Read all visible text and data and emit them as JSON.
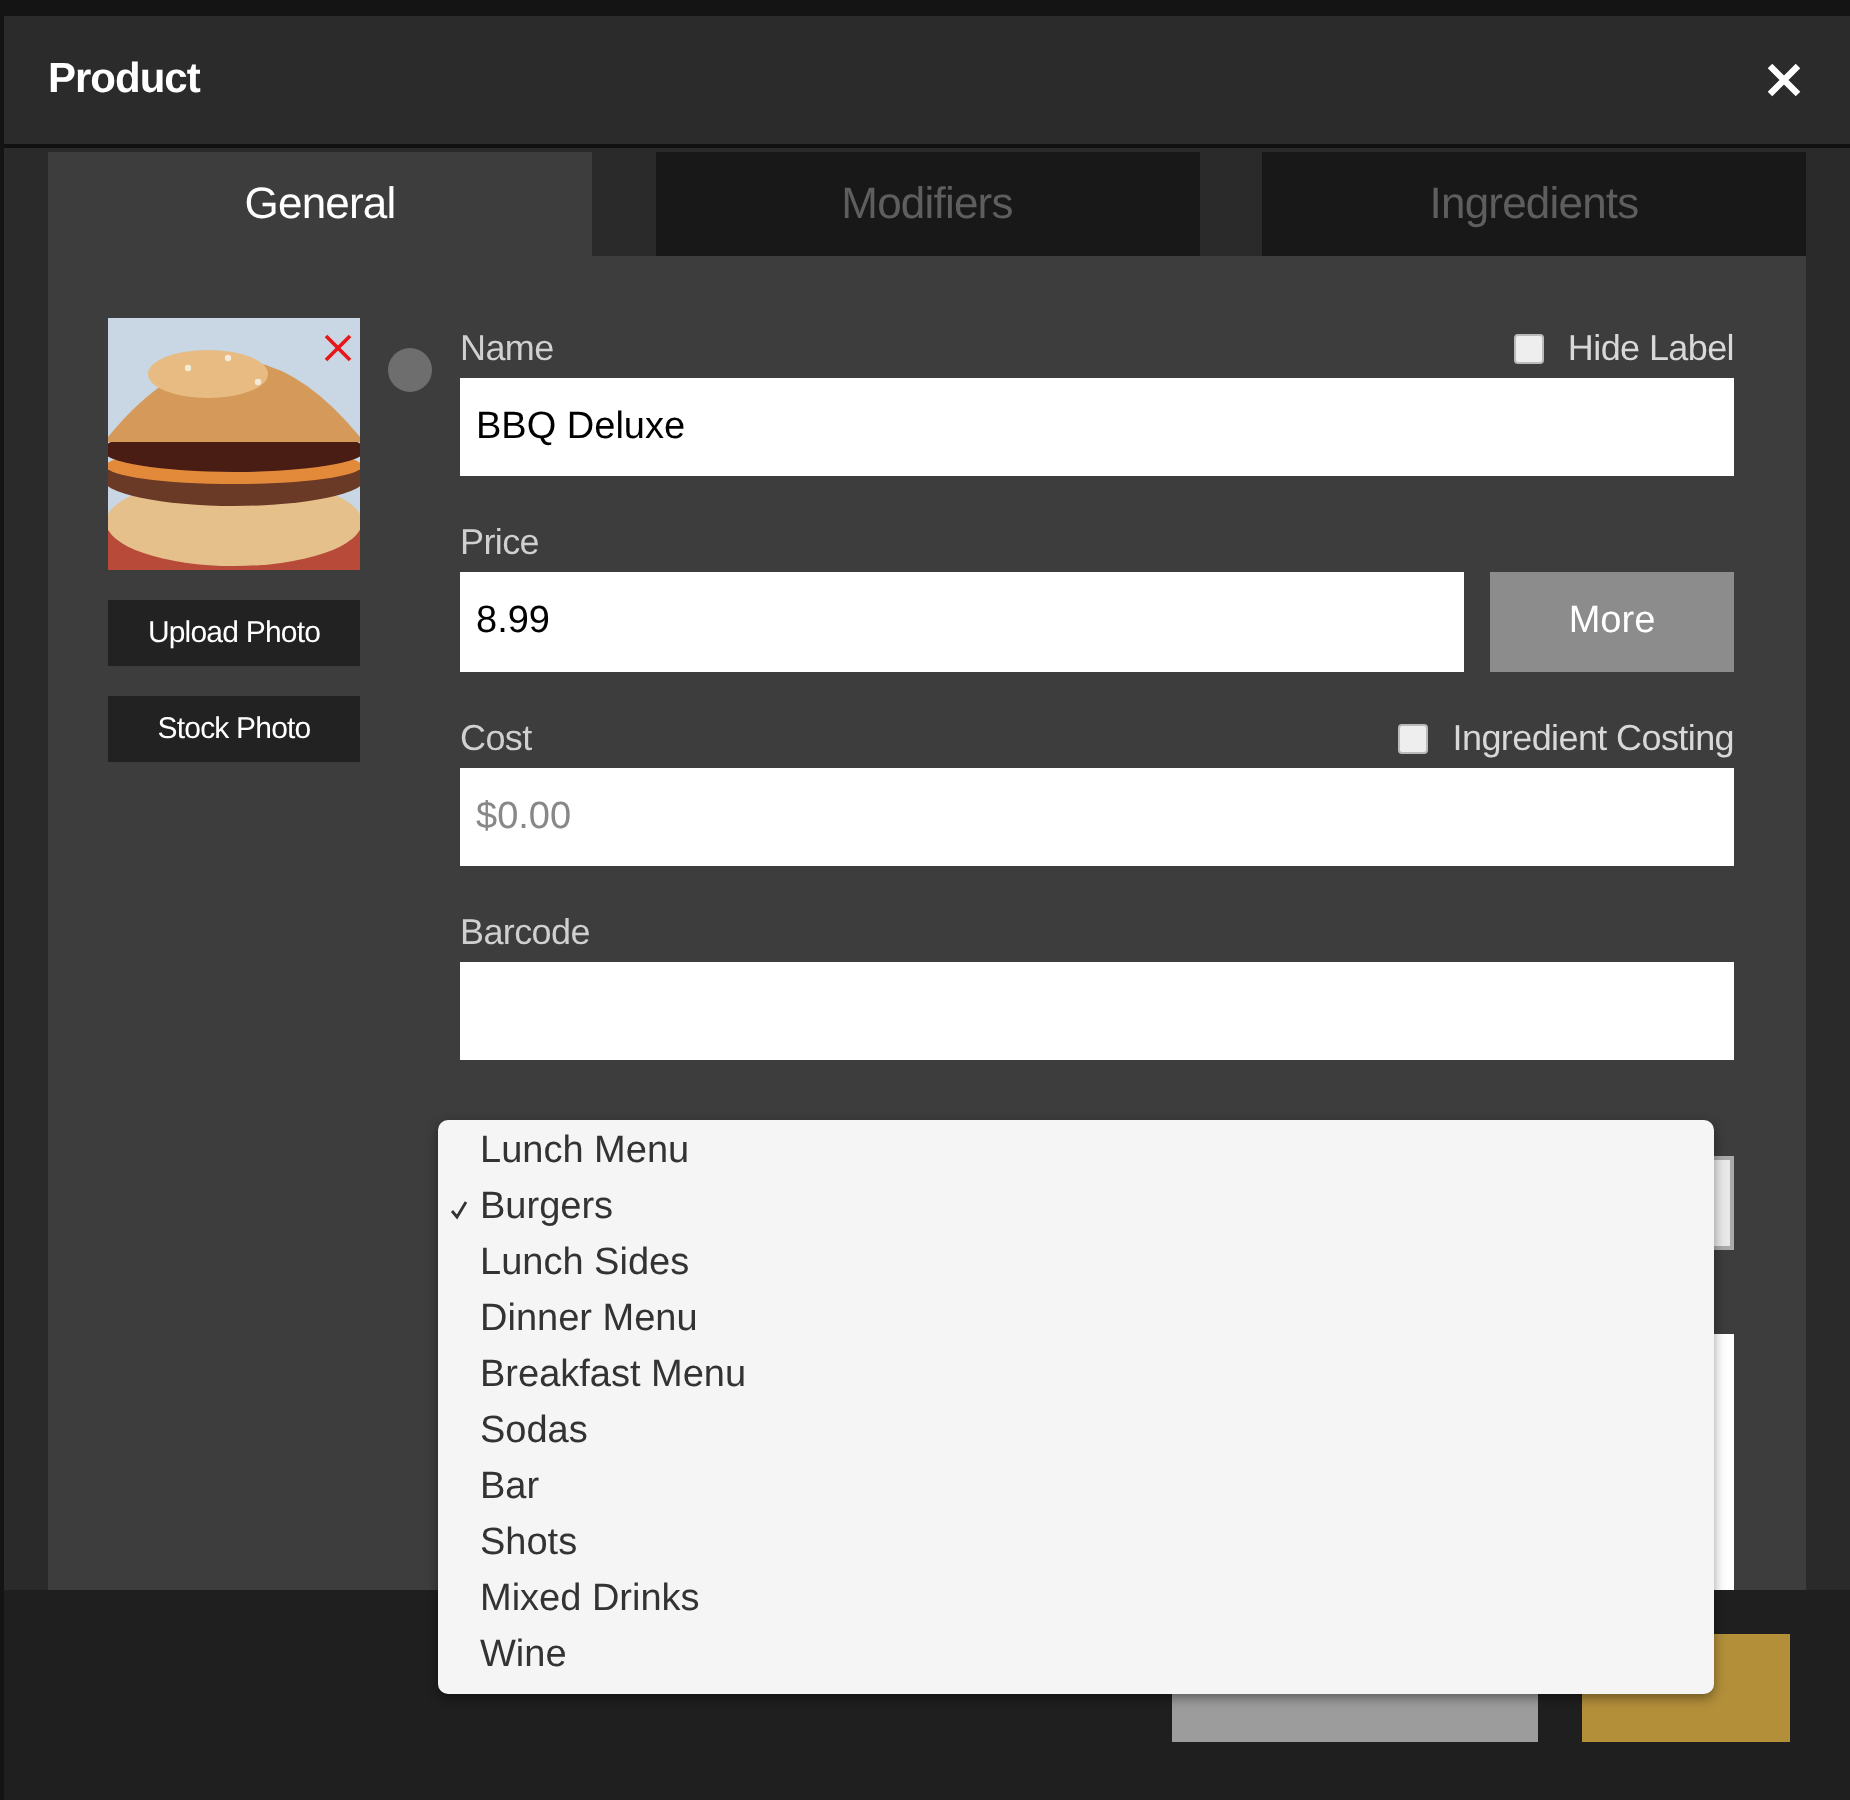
{
  "window": {
    "title": "Product"
  },
  "tabs": [
    {
      "label": "General",
      "selected": true
    },
    {
      "label": "Modifiers",
      "selected": false
    },
    {
      "label": "Ingredients",
      "selected": false
    }
  ],
  "photo": {
    "kind": "picture",
    "buttons": [
      "Upload Photo",
      "Stock Photo"
    ]
  },
  "form": {
    "name": {
      "label": "Name",
      "value": "BBQ Deluxe"
    },
    "hide_label": {
      "label": "Hide Label",
      "checked": false
    },
    "price": {
      "label": "Price",
      "value": "8.99"
    },
    "more_button": "More",
    "cost": {
      "label": "Cost",
      "placeholder": "$0.00"
    },
    "ingredient_costing": {
      "label": "Ingredient Costing",
      "checked": false
    },
    "barcode": {
      "label": "Barcode"
    }
  },
  "dropdown": {
    "options": [
      {
        "label": "Lunch Menu",
        "selected": false
      },
      {
        "label": "Burgers",
        "selected": true
      },
      {
        "label": "Lunch Sides",
        "selected": false
      },
      {
        "label": "Dinner Menu",
        "selected": false
      },
      {
        "label": "Breakfast Menu",
        "selected": false
      },
      {
        "label": "Sodas",
        "selected": false
      },
      {
        "label": "Bar",
        "selected": false
      },
      {
        "label": "Shots",
        "selected": false
      },
      {
        "label": "Mixed Drinks",
        "selected": false
      },
      {
        "label": "Wine",
        "selected": false
      }
    ]
  },
  "footer": {
    "buttons": [
      {
        "kind": "secondary"
      },
      {
        "kind": "primary"
      }
    ]
  }
}
